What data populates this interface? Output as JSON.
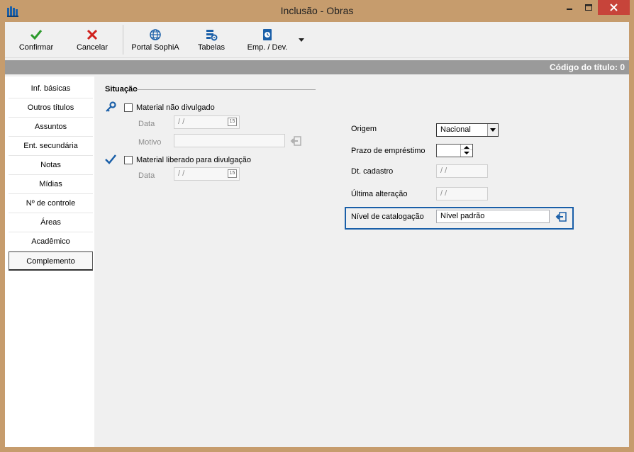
{
  "window": {
    "title": "Inclusão - Obras"
  },
  "colors": {
    "title_bg": "#c69c6d",
    "close_btn": "#c7443a",
    "highlight": "#1a5fa8",
    "code_bar": "#9a9a9a",
    "confirm_icon": "#2c9a2c",
    "cancel_icon": "#d0201c"
  },
  "toolbar": {
    "confirm_label": "Confirmar",
    "cancel_label": "Cancelar",
    "portal_label": "Portal SophiA",
    "tables_label": "Tabelas",
    "loan_label": "Emp. / Dev."
  },
  "code_bar": {
    "text": "Código do título: 0"
  },
  "sidebar": {
    "items": [
      {
        "label": "Inf. básicas"
      },
      {
        "label": "Outros títulos"
      },
      {
        "label": "Assuntos"
      },
      {
        "label": "Ent. secundária"
      },
      {
        "label": "Notas"
      },
      {
        "label": "Mídias"
      },
      {
        "label": "Nº de controle"
      },
      {
        "label": "Áreas"
      },
      {
        "label": "Acadêmico"
      },
      {
        "label": "Complemento"
      }
    ],
    "selected": "Complemento"
  },
  "situacao": {
    "title": "Situação",
    "not_published": {
      "label": "Material não divulgado",
      "checked": false,
      "date_label": "Data",
      "date_value": " / /",
      "reason_label": "Motivo",
      "reason_value": ""
    },
    "released": {
      "label": "Material liberado para divulgação",
      "checked": false,
      "date_label": "Data",
      "date_value": " / /"
    }
  },
  "right": {
    "origin_label": "Origem",
    "origin_value": "Nacional",
    "loan_term_label": "Prazo de empréstimo",
    "loan_term_value": "",
    "created_label": "Dt. cadastro",
    "created_value": " / /",
    "last_change_label": "Última alteração",
    "last_change_value": " / /",
    "catalog_level_label": "Nível de catalogação",
    "catalog_level_value": "Nível padrão"
  },
  "icons": {
    "app": "library-books-icon",
    "confirm": "check-icon",
    "cancel": "x-icon",
    "portal": "globe-icon",
    "tables": "tables-gear-icon",
    "loan": "loan-book-icon",
    "calendar": "calendar-icon",
    "calendar_text": "15",
    "action": "return-arrow-icon"
  }
}
